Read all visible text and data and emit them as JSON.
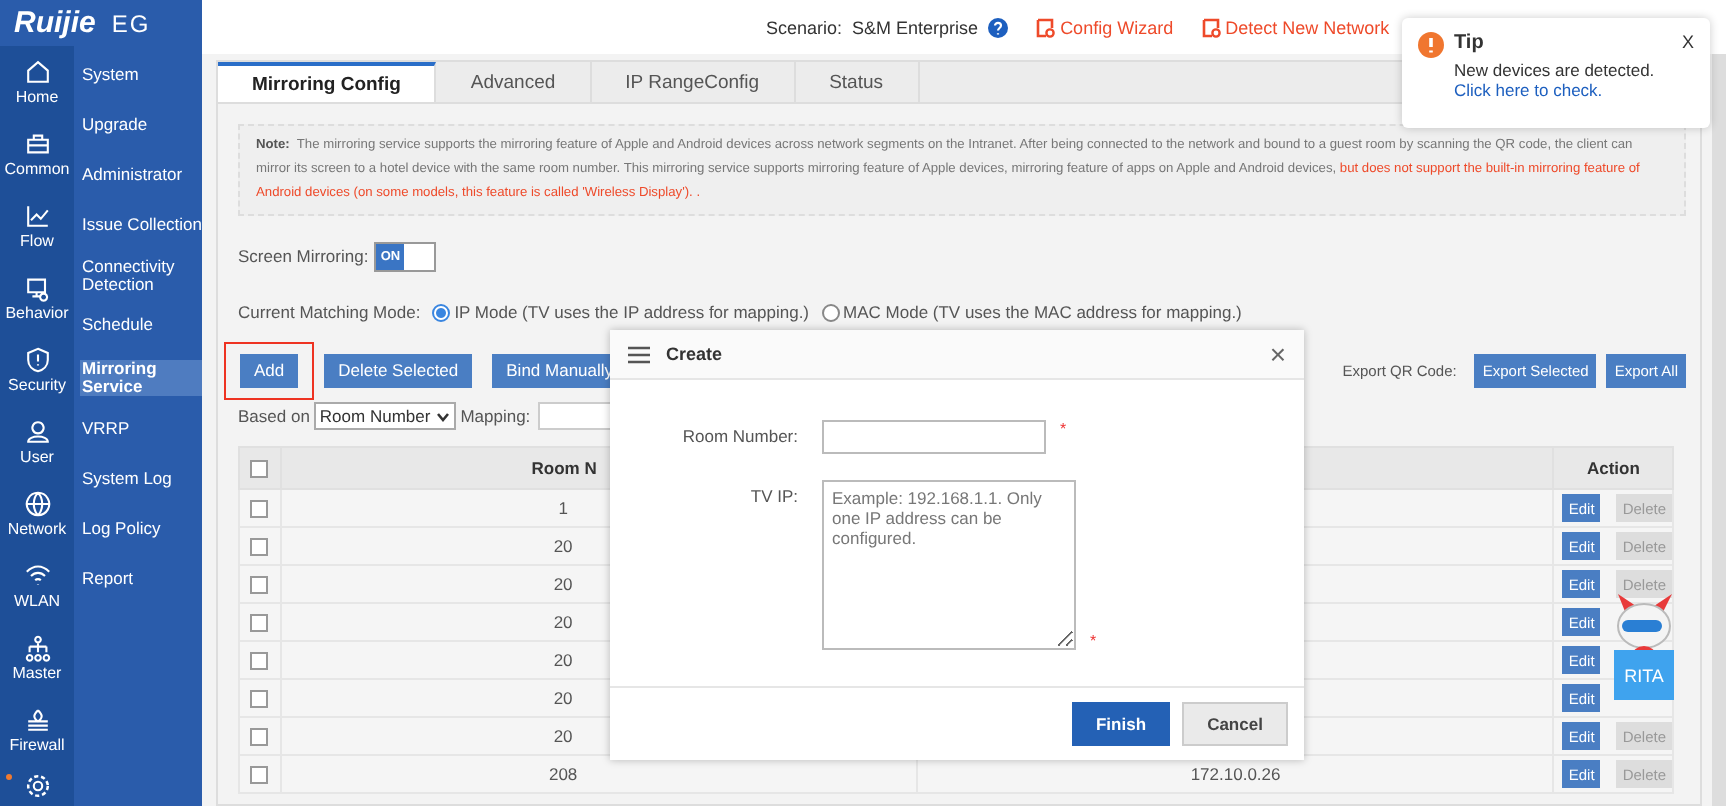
{
  "logo": {
    "brand": "Ruijie",
    "product": "EG"
  },
  "header": {
    "scenario_label": "Scenario:",
    "scenario": "S&M Enterprise",
    "links": [
      "Config Wizard",
      "Detect New Network"
    ]
  },
  "rail": [
    {
      "label": "Home"
    },
    {
      "label": "Common"
    },
    {
      "label": "Flow"
    },
    {
      "label": "Behavior"
    },
    {
      "label": "Security"
    },
    {
      "label": "User"
    },
    {
      "label": "Network"
    },
    {
      "label": "WLAN"
    },
    {
      "label": "Master"
    },
    {
      "label": "Firewall"
    }
  ],
  "submenu": [
    {
      "label": "System",
      "selected": false
    },
    {
      "label": "Upgrade",
      "selected": false
    },
    {
      "label": "Administrator",
      "selected": false
    },
    {
      "label": "Issue Collection",
      "selected": false
    },
    {
      "label": "Connectivity Detection",
      "selected": false
    },
    {
      "label": "Schedule",
      "selected": false
    },
    {
      "label": "Mirroring Service",
      "selected": true
    },
    {
      "label": "VRRP",
      "selected": false
    },
    {
      "label": "System Log",
      "selected": false
    },
    {
      "label": "Log Policy",
      "selected": false
    },
    {
      "label": "Report",
      "selected": false
    }
  ],
  "tabs": [
    {
      "label": "Mirroring Config",
      "selected": true
    },
    {
      "label": "Advanced",
      "selected": false
    },
    {
      "label": "IP RangeConfig",
      "selected": false
    },
    {
      "label": "Status",
      "selected": false
    }
  ],
  "note": {
    "label": "Note:",
    "text": "The mirroring service supports the mirroring feature of Apple and Android devices across network segments on the Intranet. After being connected to the network and bound to a guest room by scanning the QR code, the client can mirror its screen to a hotel device with the same room number. This mirroring service supports mirroring feature of Apple devices, mirroring feature of apps on Apple and Android devices,",
    "warning": "but does not support the built-in mirroring feature of Android devices (on some models, this feature is called 'Wireless Display'). ."
  },
  "screen_mirroring": {
    "label": "Screen Mirroring:",
    "on": true,
    "state_text": "ON"
  },
  "matching_mode": {
    "label": "Current Matching Mode:",
    "options": [
      {
        "label": "IP Mode (TV uses the IP address for mapping.)",
        "selected": true
      },
      {
        "label": "MAC Mode (TV uses the MAC address for mapping.)",
        "selected": false
      }
    ]
  },
  "actions": [
    "Add",
    "Delete Selected",
    "Bind Manually"
  ],
  "export": {
    "label": "Export QR Code:",
    "buttons": [
      "Export Selected",
      "Export All"
    ]
  },
  "filter": {
    "label": "Based on",
    "select": "Room Number",
    "mapping_label": "Mapping:"
  },
  "table": {
    "columns": [
      "Room N",
      "Action"
    ],
    "all_checked": false,
    "rows": [
      {
        "checked": false,
        "room": "1",
        "edit": "Edit",
        "delete": "Delete"
      },
      {
        "checked": false,
        "room": "20",
        "edit": "Edit",
        "delete": "Delete"
      },
      {
        "checked": false,
        "room": "20",
        "edit": "Edit",
        "delete": "Delete"
      },
      {
        "checked": false,
        "room": "20",
        "edit": "Edit"
      },
      {
        "checked": false,
        "room": "20",
        "edit": "Edit"
      },
      {
        "checked": false,
        "room": "20",
        "edit": "Edit"
      },
      {
        "checked": false,
        "room": "20",
        "edit": "Edit",
        "delete": "Delete"
      },
      {
        "checked": false,
        "room": "208",
        "ip": "172.10.0.26",
        "edit": "Edit",
        "delete": "Delete"
      }
    ]
  },
  "dialog": {
    "title": "Create",
    "close": "×",
    "fields": [
      {
        "label": "Room Number:",
        "kind": "input"
      },
      {
        "label": "TV IP:",
        "kind": "textarea",
        "placeholder": "Example: 192.168.1.1. Only one IP address can be configured."
      }
    ],
    "required": "*",
    "buttons": [
      "Finish",
      "Cancel"
    ]
  },
  "tip": {
    "title": "Tip",
    "close": "X",
    "message": "New devices are detected.",
    "link": "Click here to check."
  },
  "assistant": {
    "label": "RITA"
  }
}
